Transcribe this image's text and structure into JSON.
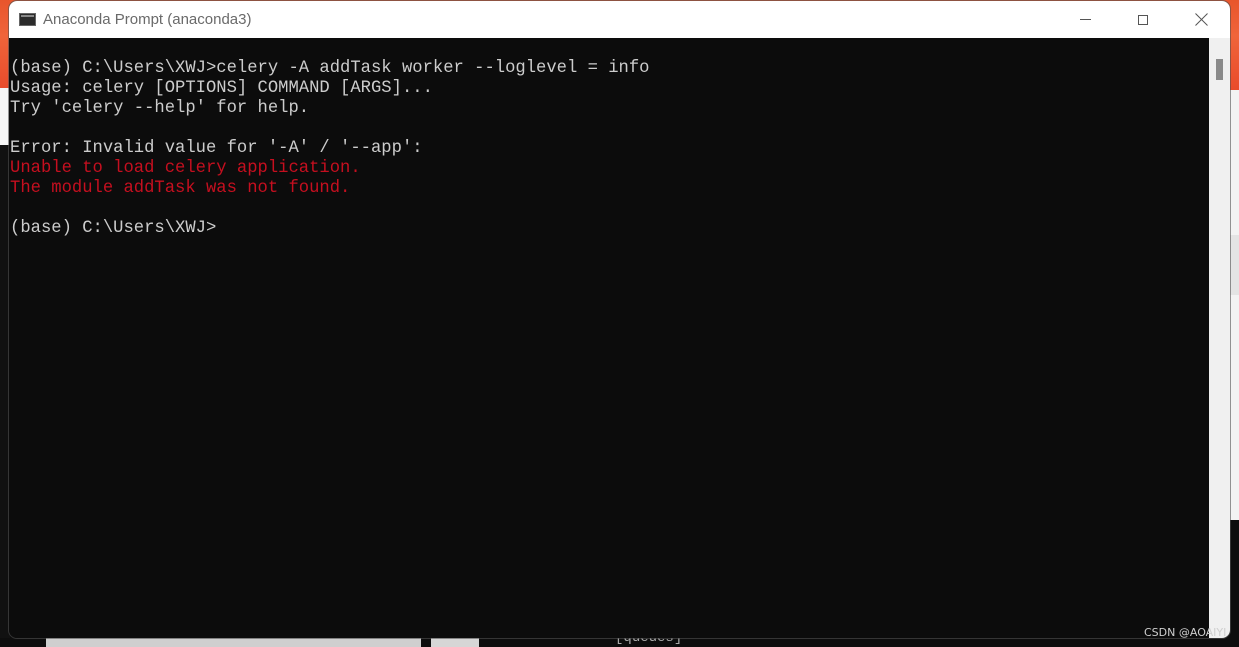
{
  "window": {
    "title": "Anaconda Prompt (anaconda3)",
    "icon": "terminal-icon",
    "controls": {
      "minimize": "minimize-icon",
      "maximize": "maximize-icon",
      "close": "close-icon"
    }
  },
  "console": {
    "lines": [
      {
        "text": "(base) C:\\Users\\XWJ>celery -A addTask worker --loglevel = info",
        "type": "normal"
      },
      {
        "text": "Usage: celery [OPTIONS] COMMAND [ARGS]...",
        "type": "normal"
      },
      {
        "text": "Try 'celery --help' for help.",
        "type": "normal"
      },
      {
        "text": "",
        "type": "normal"
      },
      {
        "text": "Error: Invalid value for '-A' / '--app':",
        "type": "normal"
      },
      {
        "text": "Unable to load celery application.",
        "type": "error"
      },
      {
        "text": "The module addTask was not found.",
        "type": "error"
      },
      {
        "text": "",
        "type": "normal"
      },
      {
        "text": "(base) C:\\Users\\XWJ>",
        "type": "normal"
      }
    ],
    "colors": {
      "background": "#0c0c0c",
      "foreground": "#cccccc",
      "error": "#c50f1f"
    }
  },
  "background": {
    "partial_text": "-------------- [queues]"
  },
  "watermark": "CSDN @AOAIYI"
}
